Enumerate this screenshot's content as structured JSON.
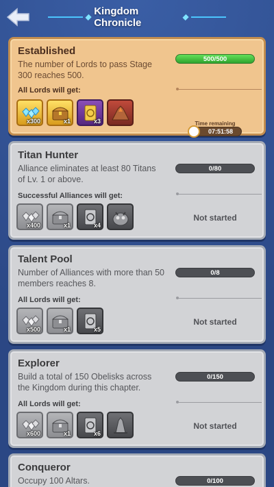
{
  "header": {
    "title": "Kingdom Chronicle",
    "back_icon": "back-arrow-icon"
  },
  "colors": {
    "background": "#2e4d8f",
    "active_card": "#f0c58e",
    "inactive_card": "#d2d3d6",
    "progress_green": "#3fbe3c",
    "accent_blue": "#4cc6ff"
  },
  "cards": [
    {
      "title": "Established",
      "description": "The number of Lords to pass Stage 300 reaches 500.",
      "reward_label": "All Lords will get:",
      "progress_text": "500/500",
      "progress_fraction": 1.0,
      "timer_label": "Time remaining",
      "timer_value": "07:51:58",
      "items": [
        {
          "icon": "gems-icon",
          "count": "x300"
        },
        {
          "icon": "treasure-chest-icon",
          "count": "x1"
        },
        {
          "icon": "scroll-card-icon",
          "count": "x3"
        },
        {
          "icon": "volcano-rock-icon",
          "count": ""
        }
      ]
    },
    {
      "title": "Titan Hunter",
      "description": "Alliance eliminates at least 80 Titans of Lv. 1 or above.",
      "reward_label": "Successful Alliances will get:",
      "progress_text": "0/80",
      "progress_fraction": 0,
      "status": "Not started",
      "items": [
        {
          "icon": "gems-icon",
          "count": "x400"
        },
        {
          "icon": "treasure-chest-icon",
          "count": "x1"
        },
        {
          "icon": "scroll-card-icon",
          "count": "x4"
        },
        {
          "icon": "titan-monster-icon",
          "count": ""
        }
      ]
    },
    {
      "title": "Talent Pool",
      "description": "Number of Alliances with more than 50 members reaches 8.",
      "reward_label": "All Lords will get:",
      "progress_text": "0/8",
      "progress_fraction": 0,
      "status": "Not started",
      "items": [
        {
          "icon": "gems-icon",
          "count": "x500"
        },
        {
          "icon": "treasure-chest-icon",
          "count": "x1"
        },
        {
          "icon": "scroll-card-icon",
          "count": "x5"
        }
      ]
    },
    {
      "title": "Explorer",
      "description": "Build a total of 150 Obelisks across the Kingdom during this chapter.",
      "reward_label": "All Lords will get:",
      "progress_text": "0/150",
      "progress_fraction": 0,
      "status": "Not started",
      "items": [
        {
          "icon": "gems-icon",
          "count": "x600"
        },
        {
          "icon": "treasure-chest-icon",
          "count": "x1"
        },
        {
          "icon": "scroll-card-icon",
          "count": "x6"
        },
        {
          "icon": "obelisk-statue-icon",
          "count": ""
        }
      ]
    },
    {
      "title": "Conqueror",
      "description": "Occupy 100 Altars.",
      "progress_text": "0/100",
      "progress_fraction": 0
    }
  ]
}
